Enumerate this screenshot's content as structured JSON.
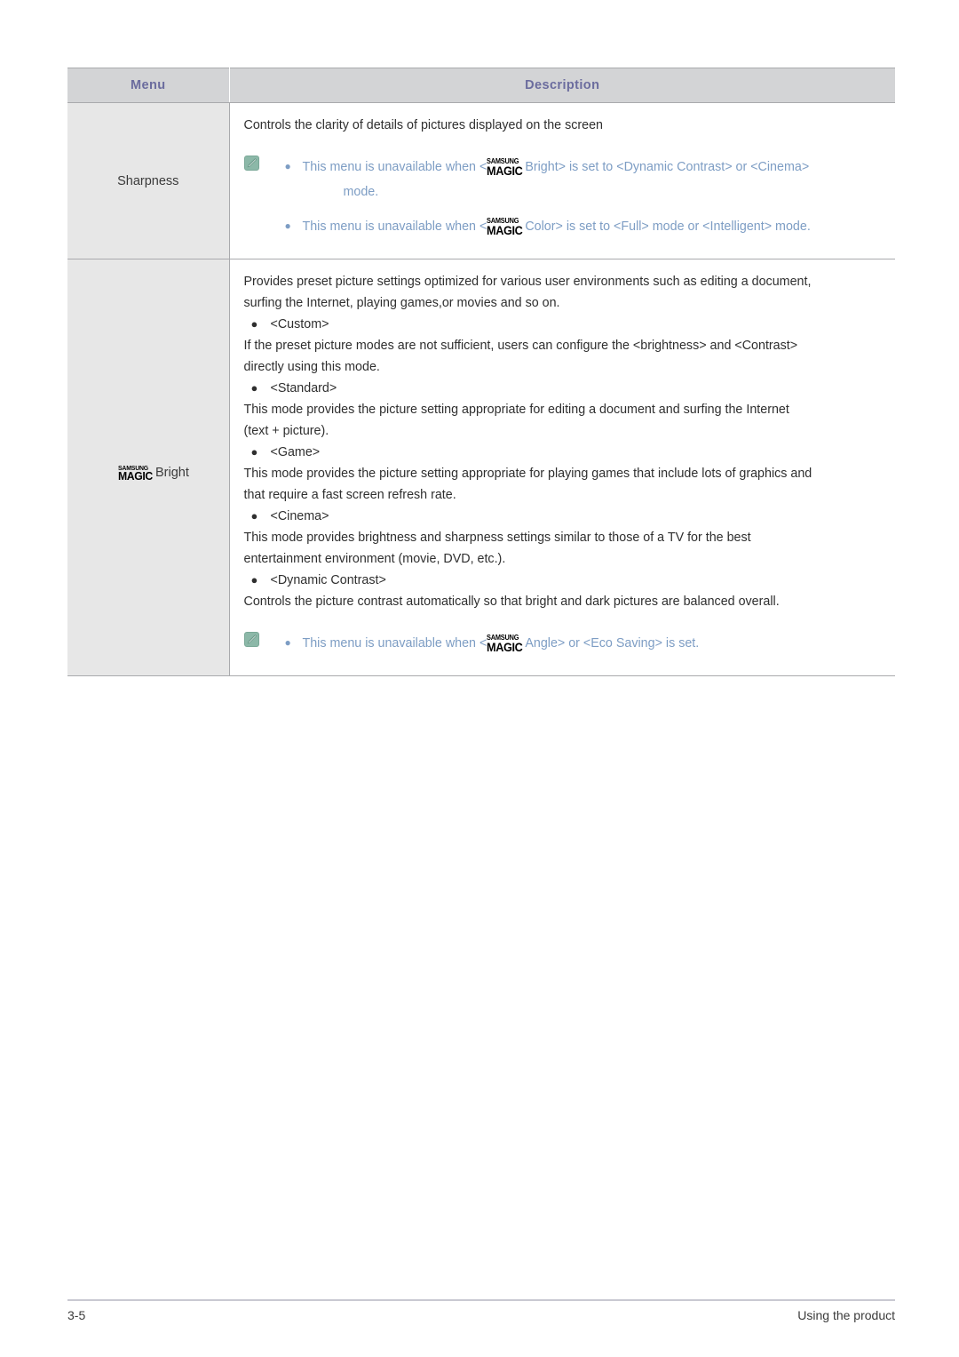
{
  "document": {
    "brand_logo": {
      "top": "SAMSUNG",
      "bottom": "MAGIC"
    }
  },
  "table": {
    "headers": {
      "menu": "Menu",
      "description": "Description"
    },
    "header_text_color": "#6b6c9e",
    "header_bg_color": "#d3d4d6",
    "menu_cell_bg_color": "#e7e7e7",
    "note_text_color": "#7d9dc4",
    "note_icon_color": "#8cb8a8",
    "rows": [
      {
        "menu": "Sharpness",
        "menu_has_logo": false,
        "intro": "Controls the clarity of details of pictures displayed on the screen",
        "notes": [
          {
            "lead": "This menu is unavailable when <",
            "logo": true,
            "tail": "Bright> is set to <Dynamic Contrast> or <Cinema>",
            "continuation": "mode."
          },
          {
            "lead": "This menu is unavailable when <",
            "logo": true,
            "tail": "Color> is set to <Full> mode or <Intelligent> mode.",
            "continuation": ""
          }
        ]
      },
      {
        "menu": "Bright",
        "menu_has_logo": true,
        "intro_lines": [
          "Provides preset picture settings optimized for various user environments such as editing a document,",
          "surfing the Internet, playing games,or movies and so on."
        ],
        "items": [
          {
            "bullet": "<Custom>",
            "body_lines": [
              "If the preset picture modes are not sufficient, users can configure the <brightness> and <Contrast>",
              "directly using this mode."
            ]
          },
          {
            "bullet": "<Standard>",
            "body_lines": [
              " This mode provides the picture setting appropriate for editing a document and surfing the Internet",
              "(text + picture)."
            ]
          },
          {
            "bullet": "<Game>",
            "body_lines": [
              "This mode provides the picture setting appropriate for playing games that include lots of graphics and",
              "that require a fast screen refresh rate."
            ]
          },
          {
            "bullet": "<Cinema>",
            "body_lines": [
              "This mode provides brightness and sharpness settings similar to those of a TV for the best",
              "entertainment environment (movie, DVD, etc.)."
            ]
          },
          {
            "bullet": "<Dynamic Contrast>",
            "body_lines": [
              "Controls the picture contrast automatically so that bright and dark pictures are balanced overall."
            ]
          }
        ],
        "notes": [
          {
            "lead": "This menu is unavailable when <",
            "logo": true,
            "tail": "Angle> or <Eco Saving> is set.",
            "continuation": ""
          }
        ]
      }
    ]
  },
  "footer": {
    "page_number": "3-5",
    "section": "Using the product"
  }
}
